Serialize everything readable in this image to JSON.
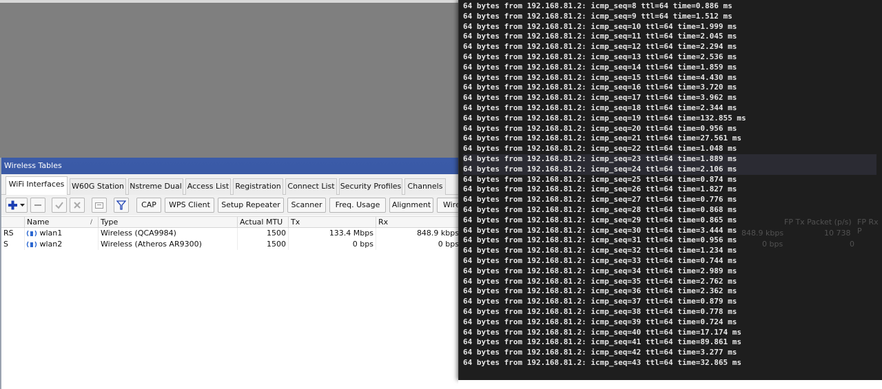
{
  "window": {
    "title": "Wireless Tables"
  },
  "tabs": [
    "WiFi Interfaces",
    "W60G Station",
    "Nstreme Dual",
    "Access List",
    "Registration",
    "Connect List",
    "Security Profiles",
    "Channels"
  ],
  "toolbar": {
    "add_icon": "plus-icon",
    "buttons": [
      "CAP",
      "WPS Client",
      "Setup Repeater",
      "Scanner",
      "Freq. Usage",
      "Alignment",
      "Wire"
    ]
  },
  "table": {
    "columns": [
      "Name",
      "Type",
      "Actual MTU",
      "Tx",
      "Rx"
    ],
    "extra_columns": [
      "FP Tx Packet (p/s)",
      "FP Rx P"
    ],
    "rows": [
      {
        "flags": "RS",
        "name": "wlan1",
        "type": "Wireless (QCA9984)",
        "mtu": "1500",
        "tx": "133.4 Mbps",
        "rx": "848.9 kbps",
        "rx_dup": "848.9 kbps",
        "fp_tx": "10 738"
      },
      {
        "flags": "S",
        "name": "wlan2",
        "type": "Wireless (Atheros AR9300)",
        "mtu": "1500",
        "tx": "0 bps",
        "rx": "0 bps",
        "rx_dup": "0 bps",
        "fp_tx": "0"
      }
    ]
  },
  "terminal": {
    "lines": [
      "64 bytes from 192.168.81.2: icmp_seq=8 ttl=64 time=0.886 ms",
      "64 bytes from 192.168.81.2: icmp_seq=9 ttl=64 time=1.512 ms",
      "64 bytes from 192.168.81.2: icmp_seq=10 ttl=64 time=1.999 ms",
      "64 bytes from 192.168.81.2: icmp_seq=11 ttl=64 time=2.045 ms",
      "64 bytes from 192.168.81.2: icmp_seq=12 ttl=64 time=2.294 ms",
      "64 bytes from 192.168.81.2: icmp_seq=13 ttl=64 time=2.536 ms",
      "64 bytes from 192.168.81.2: icmp_seq=14 ttl=64 time=1.859 ms",
      "64 bytes from 192.168.81.2: icmp_seq=15 ttl=64 time=4.430 ms",
      "64 bytes from 192.168.81.2: icmp_seq=16 ttl=64 time=3.720 ms",
      "64 bytes from 192.168.81.2: icmp_seq=17 ttl=64 time=3.962 ms",
      "64 bytes from 192.168.81.2: icmp_seq=18 ttl=64 time=2.344 ms",
      "64 bytes from 192.168.81.2: icmp_seq=19 ttl=64 time=132.855 ms",
      "64 bytes from 192.168.81.2: icmp_seq=20 ttl=64 time=0.956 ms",
      "64 bytes from 192.168.81.2: icmp_seq=21 ttl=64 time=27.561 ms",
      "64 bytes from 192.168.81.2: icmp_seq=22 ttl=64 time=1.048 ms",
      "64 bytes from 192.168.81.2: icmp_seq=23 ttl=64 time=1.889 ms",
      "64 bytes from 192.168.81.2: icmp_seq=24 ttl=64 time=2.106 ms",
      "64 bytes from 192.168.81.2: icmp_seq=25 ttl=64 time=0.874 ms",
      "64 bytes from 192.168.81.2: icmp_seq=26 ttl=64 time=1.827 ms",
      "64 bytes from 192.168.81.2: icmp_seq=27 ttl=64 time=0.776 ms",
      "64 bytes from 192.168.81.2: icmp_seq=28 ttl=64 time=0.868 ms",
      "64 bytes from 192.168.81.2: icmp_seq=29 ttl=64 time=0.865 ms",
      "64 bytes from 192.168.81.2: icmp_seq=30 ttl=64 time=3.444 ms",
      "64 bytes from 192.168.81.2: icmp_seq=31 ttl=64 time=0.956 ms",
      "64 bytes from 192.168.81.2: icmp_seq=32 ttl=64 time=1.234 ms",
      "64 bytes from 192.168.81.2: icmp_seq=33 ttl=64 time=0.744 ms",
      "64 bytes from 192.168.81.2: icmp_seq=34 ttl=64 time=2.989 ms",
      "64 bytes from 192.168.81.2: icmp_seq=35 ttl=64 time=2.762 ms",
      "64 bytes from 192.168.81.2: icmp_seq=36 ttl=64 time=2.362 ms",
      "64 bytes from 192.168.81.2: icmp_seq=37 ttl=64 time=0.879 ms",
      "64 bytes from 192.168.81.2: icmp_seq=38 ttl=64 time=0.778 ms",
      "64 bytes from 192.168.81.2: icmp_seq=39 ttl=64 time=0.724 ms",
      "64 bytes from 192.168.81.2: icmp_seq=40 ttl=64 time=17.174 ms",
      "64 bytes from 192.168.81.2: icmp_seq=41 ttl=64 time=89.861 ms",
      "64 bytes from 192.168.81.2: icmp_seq=42 ttl=64 time=3.277 ms",
      "64 bytes from 192.168.81.2: icmp_seq=43 ttl=64 time=32.865 ms"
    ]
  }
}
